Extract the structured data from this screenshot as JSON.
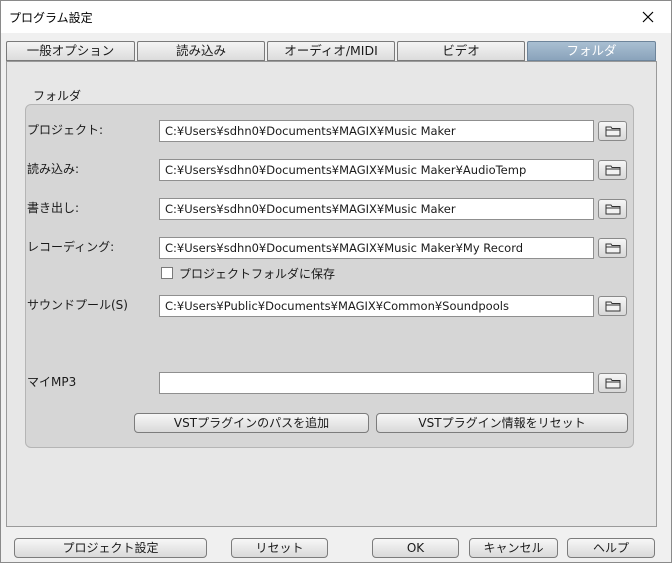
{
  "window": {
    "title": "プログラム設定"
  },
  "tabs": [
    {
      "label": "一般オプション",
      "active": false
    },
    {
      "label": "読み込み",
      "active": false
    },
    {
      "label": "オーディオ/MIDI",
      "active": false
    },
    {
      "label": "ビデオ",
      "active": false
    },
    {
      "label": "フォルダ",
      "active": true
    }
  ],
  "folders": {
    "group_label": "フォルダ",
    "project": {
      "label": "プロジェクト:",
      "value": "C:¥Users¥sdhn0¥Documents¥MAGIX¥Music Maker"
    },
    "import": {
      "label": "読み込み:",
      "value": "C:¥Users¥sdhn0¥Documents¥MAGIX¥Music Maker¥AudioTemp"
    },
    "export": {
      "label": "書き出し:",
      "value": "C:¥Users¥sdhn0¥Documents¥MAGIX¥Music Maker"
    },
    "recording": {
      "label": "レコーディング:",
      "value": "C:¥Users¥sdhn0¥Documents¥MAGIX¥Music Maker¥My Record"
    },
    "save_in_project_label": "プロジェクトフォルダに保存",
    "save_in_project_checked": false,
    "soundpool": {
      "label": "サウンドプール(S)",
      "value": "C:¥Users¥Public¥Documents¥MAGIX¥Common¥Soundpools"
    },
    "mymp3": {
      "label": "マイMP3",
      "value": ""
    },
    "add_vst_path_label": "VSTプラグインのパスを追加",
    "reset_vst_info_label": "VSTプラグイン情報をリセット"
  },
  "footer": {
    "project_settings_label": "プロジェクト設定",
    "reset_label": "リセット",
    "ok_label": "OK",
    "cancel_label": "キャンセル",
    "help_label": "ヘルプ"
  },
  "colors": {
    "active_tab": "#8aa3bb",
    "panel": "#e7e7e7",
    "group": "#d6d6d6"
  },
  "icons": {
    "close": "close-icon",
    "folder": "folder-icon"
  }
}
